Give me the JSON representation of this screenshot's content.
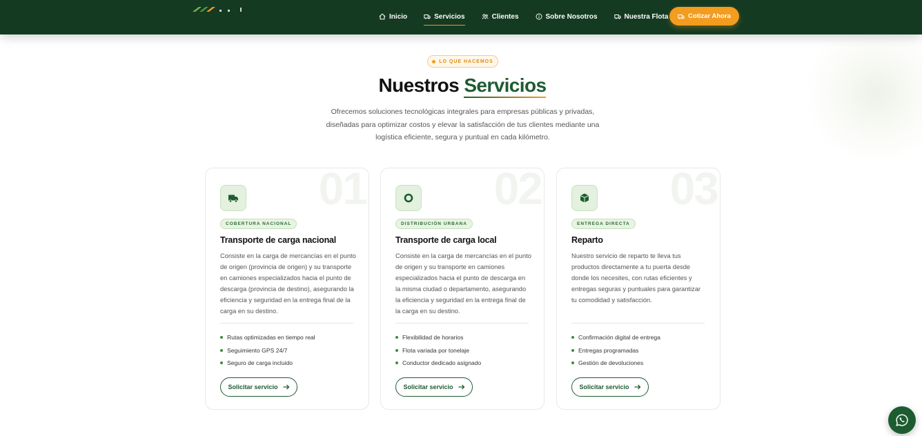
{
  "nav": {
    "items": [
      {
        "label": "Inicio",
        "icon": "home-icon"
      },
      {
        "label": "Servicios",
        "icon": "truck-icon",
        "active": true
      },
      {
        "label": "Clientes",
        "icon": "users-icon"
      },
      {
        "label": "Sobre Nosotros",
        "icon": "info-icon"
      },
      {
        "label": "Nuestra Flota",
        "icon": "truck-icon"
      }
    ],
    "cta_label": "Cotizar Ahora",
    "cta_icon": "truck-icon"
  },
  "section": {
    "pill": "LO QUE HACEMOS",
    "title_a": "Nuestros",
    "title_b": "Servicios",
    "subtitle_lines": [
      "Ofrecemos soluciones tecnológicas integrales para empresas públicas y privadas,",
      "diseñadas para optimizar costos y elevar la satisfacción de tus clientes mediante una",
      "logística eficiente, segura y puntual en cada kilómetro."
    ]
  },
  "cards": [
    {
      "num": "01",
      "icon": "truck-icon",
      "badge": "COBERTURA NACIONAL",
      "title": "Transporte de carga nacional",
      "desc": "Consiste en la carga de mercancías en el punto de origen (provincia de origen) y su transporte en camiones especializados hacia el punto de descarga (provincia de destino), asegurando la eficiencia y seguridad en la entrega final de la carga en su destino.",
      "features": [
        "Rutas optimizadas en tiempo real",
        "Seguimiento GPS 24/7",
        "Seguro de carga incluido"
      ],
      "button": "Solicitar servicio"
    },
    {
      "num": "02",
      "icon": "ring-icon",
      "badge": "DISTRIBUCIÓN URBANA",
      "title": "Transporte de carga local",
      "desc": "Consiste en la carga de mercancías en el punto de origen y su transporte en camiones especializados hacia el punto de descarga en la misma ciudad o departamento, asegurando la eficiencia y seguridad en la entrega final de la carga en su destino.",
      "features": [
        "Flexibilidad de horarios",
        "Flota variada por tonelaje",
        "Conductor dedicado asignado"
      ],
      "button": "Solicitar servicio"
    },
    {
      "num": "03",
      "icon": "box-icon",
      "badge": "ENTREGA DIRECTA",
      "title": "Reparto",
      "desc": "Nuestro servicio de reparto te lleva tus productos directamente a tu puerta desde donde los necesites, con rutas eficientes y entregas seguras y puntuales para garantizar tu comodidad y satisfacción.",
      "features": [
        "Confirmación digital de entrega",
        "Entregas programadas",
        "Gestión de devoluciones"
      ],
      "button": "Solicitar servicio"
    }
  ],
  "whatsapp_icon": "whatsapp-icon",
  "colors": {
    "primary": "#143a22",
    "accent": "#f39c1f",
    "green": "#1d5c30"
  }
}
